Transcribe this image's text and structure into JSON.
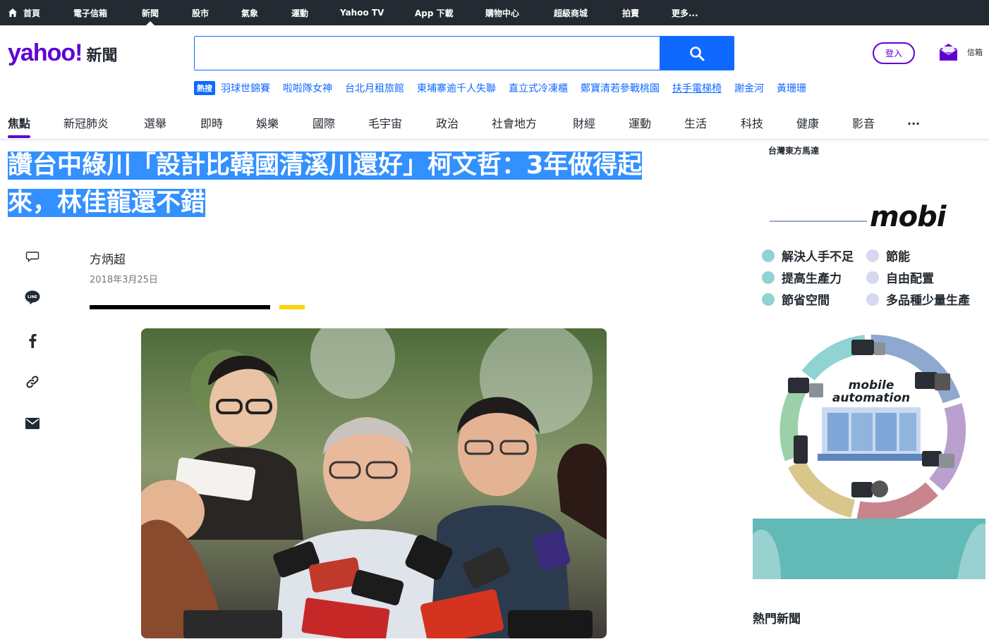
{
  "topnav": {
    "items": [
      {
        "label": "首頁",
        "icon": "home-icon"
      },
      {
        "label": "電子信箱"
      },
      {
        "label": "新聞",
        "active": true
      },
      {
        "label": "股市"
      },
      {
        "label": "氣象"
      },
      {
        "label": "運動"
      },
      {
        "label": "Yahoo TV"
      },
      {
        "label": "App 下載"
      },
      {
        "label": "購物中心"
      },
      {
        "label": "超級商城"
      },
      {
        "label": "拍賣"
      },
      {
        "label": "更多..."
      }
    ]
  },
  "header": {
    "logo": "yahoo!",
    "logo_sub": "新聞",
    "search_placeholder": "",
    "login_label": "登入",
    "mail_label": "信箱"
  },
  "trending": {
    "badge": "熱搜",
    "links": [
      "羽球世錦賽",
      "啦啦隊女神",
      "台北月租旅館",
      "東埔寨逾千人失聯",
      "直立式冷凍櫃",
      "鄭寶清若參戰桃園",
      "扶手電梯椅",
      "謝金河",
      "黃珊珊"
    ]
  },
  "categories": [
    "焦點",
    "新冠肺炎",
    "選舉",
    "即時",
    "娛樂",
    "國際",
    "毛宇宙",
    "政治",
    "社會地方",
    "財經",
    "運動",
    "生活",
    "科技",
    "健康",
    "影音",
    "..."
  ],
  "article": {
    "headline_line1": "讚台中綠川「設計比韓國清溪川還好」柯文哲：3年做得起",
    "headline_line2": "來，林佳龍還不錯",
    "author": "方炳超",
    "date": "2018年3月25日"
  },
  "share_icons": [
    "comment-icon",
    "line-icon",
    "facebook-icon",
    "link-icon",
    "email-icon"
  ],
  "ad": {
    "subtitle": "台灣東方馬達",
    "brand": "mobi",
    "features_left": [
      "解決人手不足",
      "提高生產力",
      "節省空間"
    ],
    "features_right": [
      "節能",
      "自由配置",
      "多品種少量生產"
    ],
    "wheel_line1": "mobile",
    "wheel_line2": "automation"
  },
  "rail": {
    "hot_news_title": "熱門新聞"
  },
  "colors": {
    "brand": "#6001d2",
    "accent": "#0f69ff",
    "topbar": "#232a31",
    "selection": "#3390ff"
  }
}
